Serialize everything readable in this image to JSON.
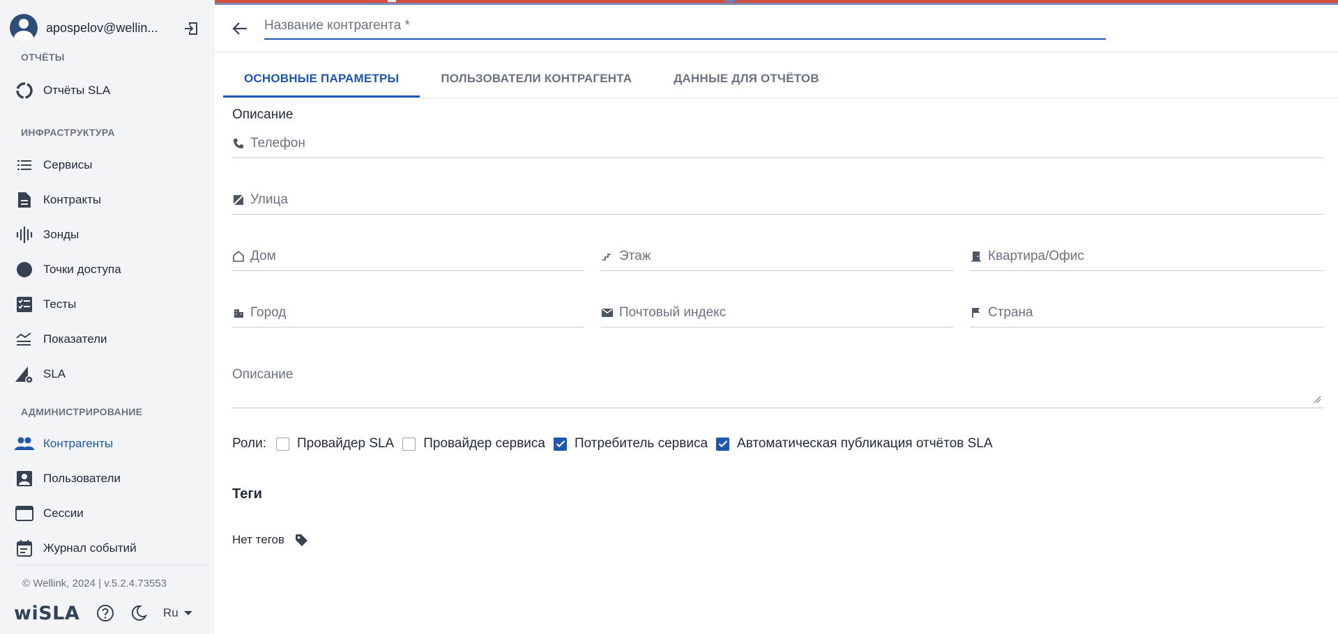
{
  "user": {
    "name": "apospelov@wellin..."
  },
  "sidebar": {
    "sections": [
      {
        "label": "ОТЧЁТЫ"
      },
      {
        "label": "ИНФРАСТРУКТУРА"
      },
      {
        "label": "АДМИНИСТРИРОВАНИЕ"
      }
    ],
    "items": [
      {
        "label": "Отчёты SLA",
        "icon": "sla-reports-icon"
      },
      {
        "label": "Сервисы",
        "icon": "list-icon"
      },
      {
        "label": "Контракты",
        "icon": "document-icon"
      },
      {
        "label": "Зонды",
        "icon": "probe-wave-icon"
      },
      {
        "label": "Точки доступа",
        "icon": "circle-icon"
      },
      {
        "label": "Тесты",
        "icon": "checklist-icon"
      },
      {
        "label": "Показатели",
        "icon": "metrics-icon"
      },
      {
        "label": "SLA",
        "icon": "sla-settings-icon"
      },
      {
        "label": "Контрагенты",
        "icon": "people-icon",
        "active": true
      },
      {
        "label": "Пользователи",
        "icon": "user-card-icon"
      },
      {
        "label": "Сессии",
        "icon": "browser-window-icon"
      },
      {
        "label": "Журнал событий",
        "icon": "calendar-icon"
      }
    ],
    "copyright": "© Wellink, 2024 | v.5.2.4.73553",
    "logo": "wiSLA",
    "language": "Ru"
  },
  "header": {
    "title_placeholder": "Название контрагента *"
  },
  "tabs": [
    {
      "label": "ОСНОВНЫЕ ПАРАМЕТРЫ",
      "active": true
    },
    {
      "label": "ПОЛЬЗОВАТЕЛИ КОНТРАГЕНТА"
    },
    {
      "label": "ДАННЫЕ ДЛЯ ОТЧЁТОВ"
    }
  ],
  "form": {
    "section_title": "Описание",
    "fields": {
      "phone": "Телефон",
      "street": "Улица",
      "house": "Дом",
      "floor": "Этаж",
      "apartment": "Квартира/Офис",
      "city": "Город",
      "postal": "Почтовый индекс",
      "country": "Страна",
      "description": "Описание"
    },
    "roles_label": "Роли:",
    "roles": [
      {
        "label": "Провайдер SLA",
        "checked": false
      },
      {
        "label": "Провайдер сервиса",
        "checked": false
      },
      {
        "label": "Потребитель сервиса",
        "checked": true
      },
      {
        "label": "Автоматическая публикация отчётов SLA",
        "checked": true
      }
    ],
    "tags_title": "Теги",
    "no_tags": "Нет тегов"
  },
  "colors": {
    "accent": "#1e56b3",
    "sidebar_bg": "#f3f4f6",
    "top_strip": "#d54b3d"
  }
}
